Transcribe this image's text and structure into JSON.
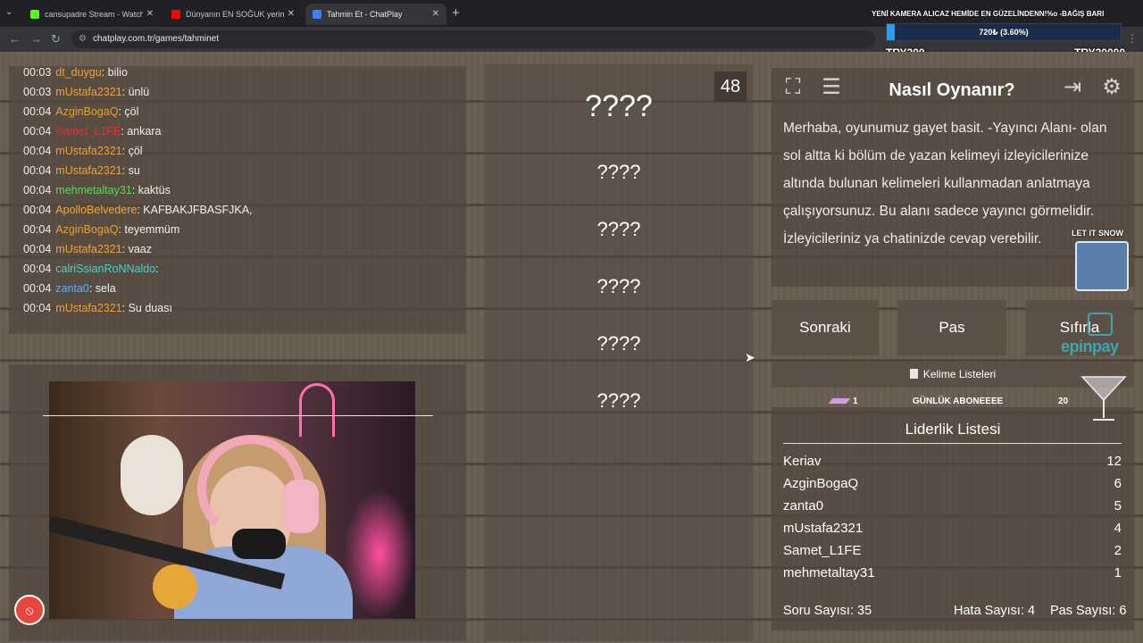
{
  "browser": {
    "tabs": [
      {
        "label": "cansupadre Stream - Watch Liv",
        "favicon_color": "#53fc18"
      },
      {
        "label": "Dünyanın EN SOĞUK yerinde B",
        "favicon_color": "#ff0000"
      },
      {
        "label": "Tahmin Et - ChatPlay",
        "favicon_color": "#3b82f6"
      }
    ],
    "url": "chatplay.com.tr/games/tahminet"
  },
  "donation": {
    "title": "YENİ KAMERA ALICAZ HEMİDE EN GÜZELİNDENN!%o -BAĞIŞ BARI",
    "progress_text": "720₺ (3.60%)",
    "progress_fraction": 0.036,
    "min": "TRY200",
    "max": "TRY20000"
  },
  "chat": [
    {
      "time": "00:03",
      "user": "dt_duygu",
      "msg": "bilio",
      "color": "#f0a23a"
    },
    {
      "time": "00:03",
      "user": "mUstafa2321",
      "msg": "ünlü",
      "color": "#f0a23a"
    },
    {
      "time": "00:04",
      "user": "AzginBogaQ",
      "msg": "çöl",
      "color": "#e0a03a"
    },
    {
      "time": "00:04",
      "user": "Samet_L1FE",
      "msg": "ankara",
      "color": "#d8323c"
    },
    {
      "time": "00:04",
      "user": "mUstafa2321",
      "msg": "çöl",
      "color": "#f0a23a"
    },
    {
      "time": "00:04",
      "user": "mUstafa2321",
      "msg": "su",
      "color": "#f0a23a"
    },
    {
      "time": "00:04",
      "user": "mehmetaltay31",
      "msg": "kaktüs",
      "color": "#5cd65c"
    },
    {
      "time": "00:04",
      "user": "ApolloBelvedere",
      "msg": "KAFBAKJFBASFJKA,",
      "color": "#f0a23a"
    },
    {
      "time": "00:04",
      "user": "AzginBogaQ",
      "msg": "teyemmüm",
      "color": "#e0a03a"
    },
    {
      "time": "00:04",
      "user": "mUstafa2321",
      "msg": "vaaz",
      "color": "#f0a23a"
    },
    {
      "time": "00:04",
      "user": "calriSsianRoNNaldo",
      "msg": "",
      "color": "#4fd1c5"
    },
    {
      "time": "00:04",
      "user": "zanta0",
      "msg": "sela",
      "color": "#6aa8ff"
    },
    {
      "time": "00:04",
      "user": "mUstafa2321",
      "msg": "Su duası",
      "color": "#f0a23a"
    }
  ],
  "game": {
    "timer": "48",
    "words": [
      "????",
      "????",
      "????",
      "????",
      "????",
      "????"
    ]
  },
  "howto": {
    "title": "Nasıl Oynanır?",
    "text": "Merhaba, oyunumuz gayet basit. -Yayıncı Alanı- olan sol altta ki bölüm de yazan kelimeyi izleyicilerinize altında bulunan kelimeleri kullanmadan anlatmaya çalışıyorsunuz. Bu alanı sadece yayıncı görmelidir. İzleyicileriniz ya chatinizde cevap verebilir.",
    "icons": [
      "fullscreen-icon",
      "notes-icon",
      "exit-icon",
      "gear-icon"
    ]
  },
  "controls": {
    "next": "Sonraki",
    "pass": "Pas",
    "reset": "Sıfırla",
    "word_lists": "Kelime Listeleri"
  },
  "sub_goal": {
    "current": "1",
    "label": "GÜNLÜK ABONEEEE",
    "target": "20"
  },
  "leaderboard": {
    "title": "Liderlik Listesi",
    "rows": [
      {
        "name": "Keriav",
        "score": "12"
      },
      {
        "name": "AzginBogaQ",
        "score": "6"
      },
      {
        "name": "zanta0",
        "score": "5"
      },
      {
        "name": "mUstafa2321",
        "score": "4"
      },
      {
        "name": "Samet_L1FE",
        "score": "2"
      },
      {
        "name": "mehmetaltay31",
        "score": "1"
      }
    ]
  },
  "stats": {
    "questions": "Soru Sayısı: 35",
    "errors": "Hata Sayısı: 4",
    "passes": "Pas Sayısı: 6"
  },
  "overlays": {
    "snow_label": "LET IT SNOW",
    "sponsor": "epinpay"
  }
}
